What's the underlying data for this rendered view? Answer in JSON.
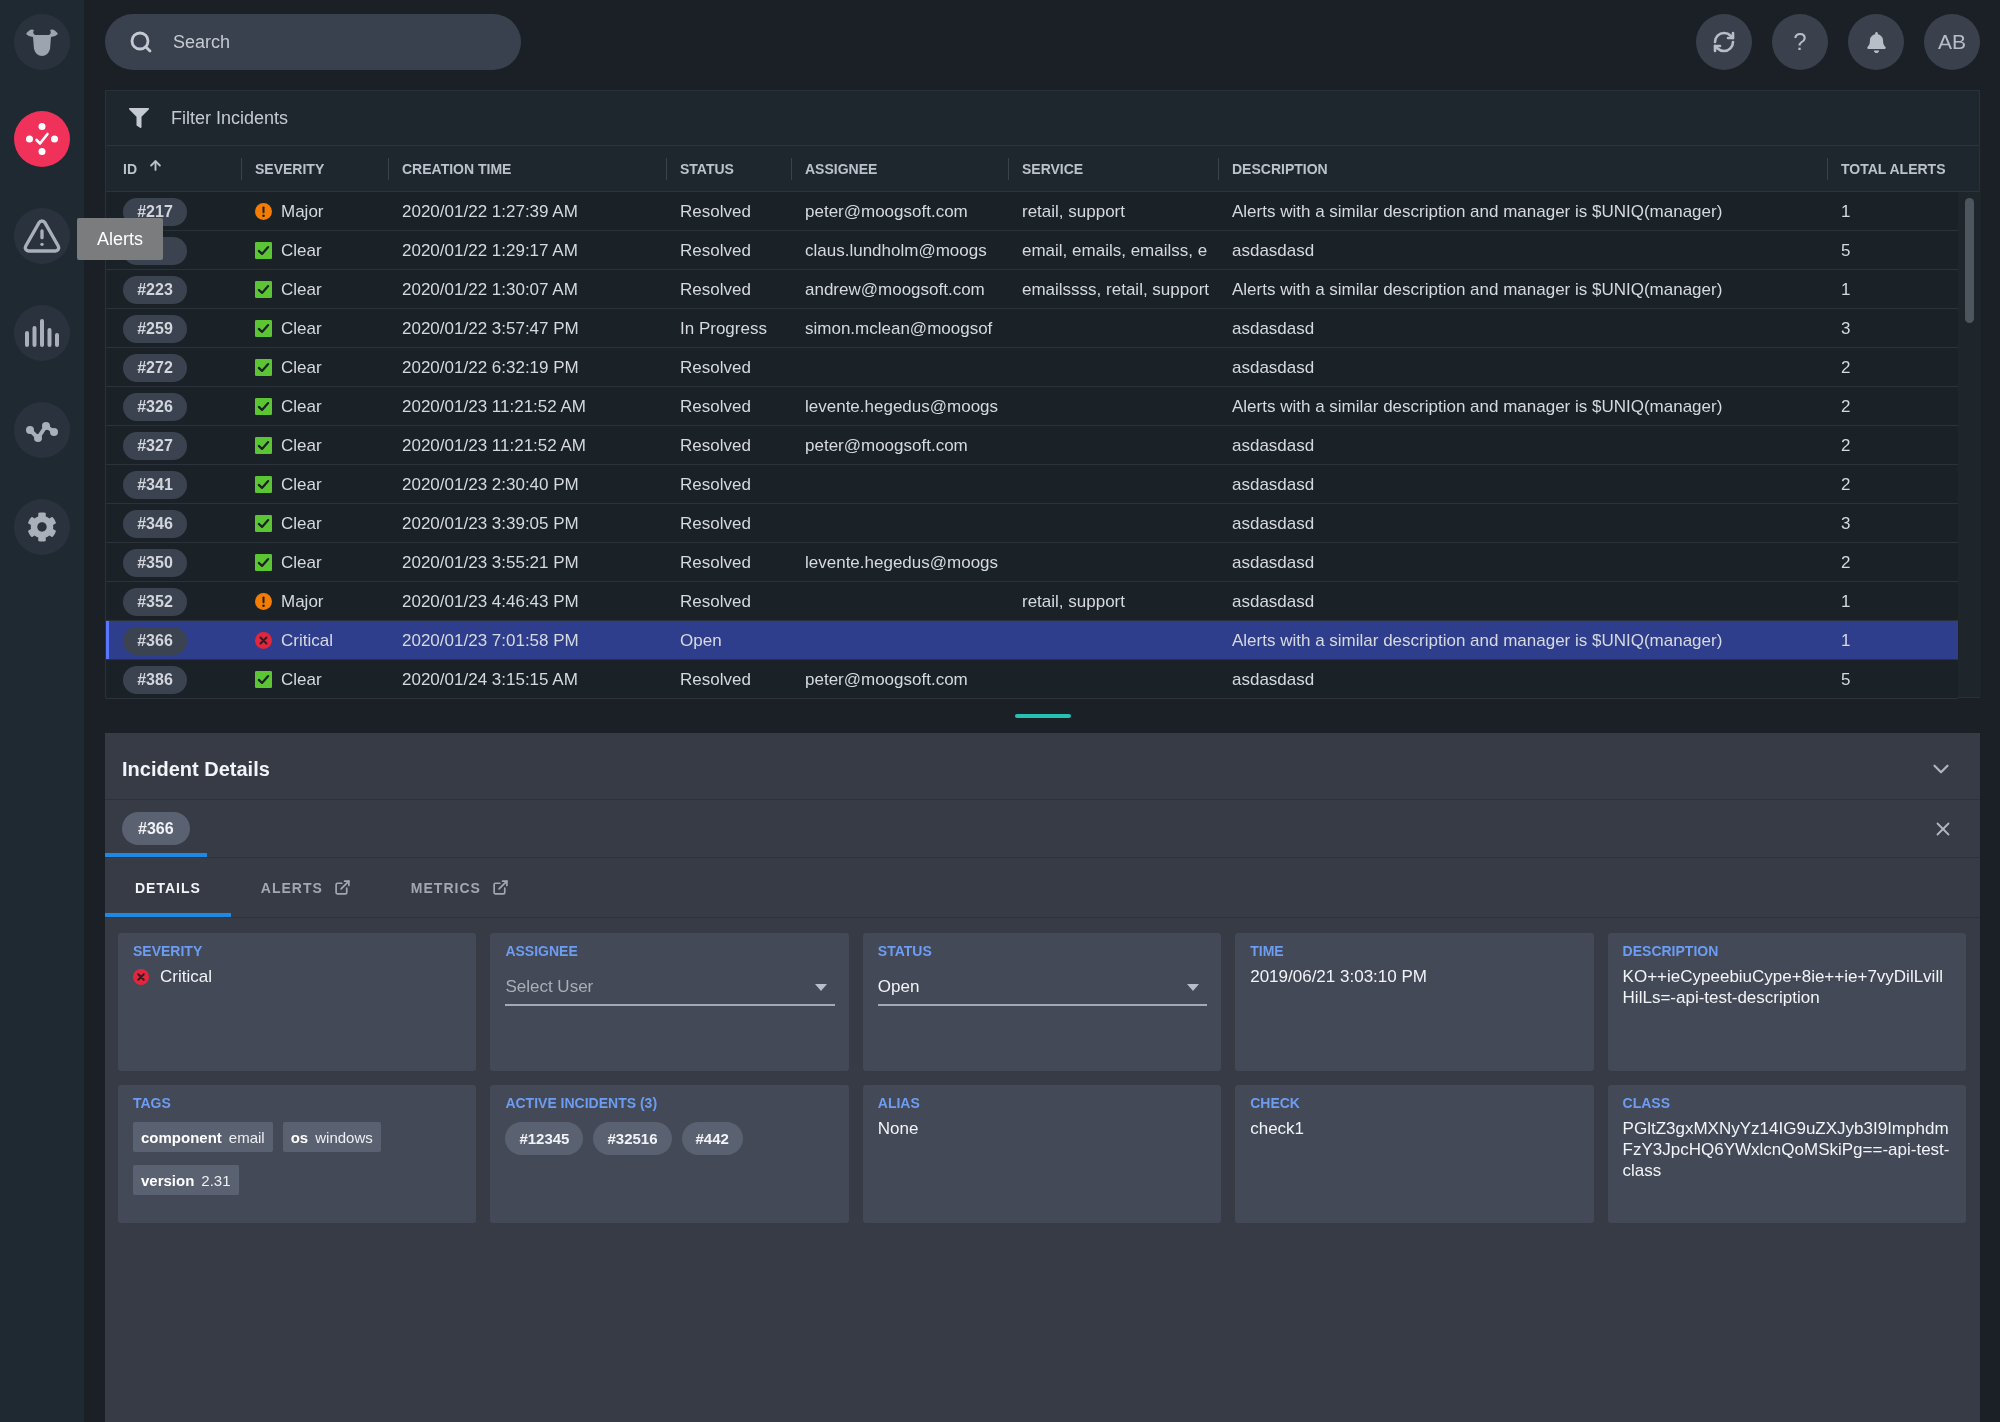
{
  "sidebar": {
    "items": [
      {
        "kind": "incidents",
        "selected": true
      },
      {
        "kind": "alerts",
        "selected": false,
        "tooltip": "Alerts"
      },
      {
        "kind": "analytics",
        "selected": false
      },
      {
        "kind": "topology",
        "selected": false
      },
      {
        "kind": "settings",
        "selected": false
      }
    ]
  },
  "top_bar": {
    "search": {
      "placeholder": "Search"
    },
    "actions": [
      {
        "kind": "refresh"
      },
      {
        "kind": "help",
        "label": "?"
      },
      {
        "kind": "notifications"
      }
    ],
    "avatar": "AB"
  },
  "incidents_table": {
    "filter": {
      "placeholder": "Filter Incidents"
    },
    "columns": [
      {
        "label": "ID",
        "sorted": true
      },
      {
        "label": "SEVERITY",
        "sorted": false
      },
      {
        "label": "CREATION TIME",
        "sorted": false
      },
      {
        "label": "STATUS",
        "sorted": false
      },
      {
        "label": "ASSIGNEE",
        "sorted": false
      },
      {
        "label": "SERVICE",
        "sorted": false
      },
      {
        "label": "DESCRIPTION",
        "sorted": false
      },
      {
        "label": "TOTAL ALERTS",
        "sorted": false
      }
    ],
    "rows": [
      {
        "id": "#217",
        "severity": {
          "label": "Major",
          "kind": "major"
        },
        "creation_time": "2020/01/22 1:27:39 AM",
        "status": "Resolved",
        "assignee": "peter@moogsoft.com",
        "service": "retail, support",
        "description": "Alerts with a similar description and manager is $UNIQ(manager)",
        "total_alerts": "1",
        "selected": false
      },
      {
        "severity": {
          "label": "Clear",
          "kind": "clear"
        },
        "creation_time": "2020/01/22 1:29:17 AM",
        "status": "Resolved",
        "assignee": "claus.lundholm@moogs",
        "service": "email, emails, emailss, e",
        "description": "asdasdasd",
        "total_alerts": "5",
        "selected": false
      },
      {
        "id": "#223",
        "severity": {
          "label": "Clear",
          "kind": "clear"
        },
        "creation_time": "2020/01/22 1:30:07 AM",
        "status": "Resolved",
        "assignee": "andrew@moogsoft.com",
        "service": "emailssss, retail, support",
        "description": "Alerts with a similar description and manager is $UNIQ(manager)",
        "total_alerts": "1",
        "selected": false
      },
      {
        "id": "#259",
        "severity": {
          "label": "Clear",
          "kind": "clear"
        },
        "creation_time": "2020/01/22 3:57:47 PM",
        "status": "In Progress",
        "assignee": "simon.mclean@moogsof",
        "description": "asdasdasd",
        "total_alerts": "3",
        "selected": false
      },
      {
        "id": "#272",
        "severity": {
          "label": "Clear",
          "kind": "clear"
        },
        "creation_time": "2020/01/22 6:32:19 PM",
        "status": "Resolved",
        "description": "asdasdasd",
        "total_alerts": "2",
        "selected": false
      },
      {
        "id": "#326",
        "severity": {
          "label": "Clear",
          "kind": "clear"
        },
        "creation_time": "2020/01/23 11:21:52 AM",
        "status": "Resolved",
        "assignee": "levente.hegedus@moogs",
        "description": "Alerts with a similar description and manager is $UNIQ(manager)",
        "total_alerts": "2",
        "selected": false
      },
      {
        "id": "#327",
        "severity": {
          "label": "Clear",
          "kind": "clear"
        },
        "creation_time": "2020/01/23 11:21:52 AM",
        "status": "Resolved",
        "assignee": "peter@moogsoft.com",
        "description": "asdasdasd",
        "total_alerts": "2",
        "selected": false
      },
      {
        "id": "#341",
        "severity": {
          "label": "Clear",
          "kind": "clear"
        },
        "creation_time": "2020/01/23 2:30:40 PM",
        "status": "Resolved",
        "description": "asdasdasd",
        "total_alerts": "2",
        "selected": false
      },
      {
        "id": "#346",
        "severity": {
          "label": "Clear",
          "kind": "clear"
        },
        "creation_time": "2020/01/23 3:39:05 PM",
        "status": "Resolved",
        "description": "asdasdasd",
        "total_alerts": "3",
        "selected": false
      },
      {
        "id": "#350",
        "severity": {
          "label": "Clear",
          "kind": "clear"
        },
        "creation_time": "2020/01/23 3:55:21 PM",
        "status": "Resolved",
        "assignee": "levente.hegedus@moogs",
        "description": "asdasdasd",
        "total_alerts": "2",
        "selected": false
      },
      {
        "id": "#352",
        "severity": {
          "label": "Major",
          "kind": "major"
        },
        "creation_time": "2020/01/23 4:46:43 PM",
        "status": "Resolved",
        "service": "retail, support",
        "description": "asdasdasd",
        "total_alerts": "1",
        "selected": false
      },
      {
        "id": "#366",
        "severity": {
          "label": "Critical",
          "kind": "critical"
        },
        "creation_time": "2020/01/23 7:01:58 PM",
        "status": "Open",
        "description": "Alerts with a similar description and manager is $UNIQ(manager)",
        "total_alerts": "1",
        "selected": true
      },
      {
        "id": "#386",
        "severity": {
          "label": "Clear",
          "kind": "clear"
        },
        "creation_time": "2020/01/24 3:15:15 AM",
        "status": "Resolved",
        "assignee": "peter@moogsoft.com",
        "description": "asdasdasd",
        "total_alerts": "5",
        "selected": false
      }
    ]
  },
  "incident_details": {
    "title": "Incident Details",
    "open_incidents": [
      {
        "label": "#366",
        "selected": true
      }
    ],
    "tabs": [
      {
        "label": "DETAILS",
        "selected": true,
        "external": false
      },
      {
        "label": "ALERTS",
        "selected": false,
        "external": true
      },
      {
        "label": "METRICS",
        "selected": false,
        "external": true
      }
    ],
    "cards": [
      {
        "kind": "severity",
        "label": "SEVERITY",
        "severity": {
          "label": "Critical",
          "kind": "critical"
        }
      },
      {
        "kind": "select",
        "label": "ASSIGNEE",
        "placeholder": "Select User"
      },
      {
        "kind": "select",
        "label": "STATUS",
        "value": "Open"
      },
      {
        "kind": "text",
        "label": "TIME",
        "value": "2019/06/21 3:03:10 PM"
      },
      {
        "kind": "text",
        "label": "DESCRIPTION",
        "value": "KO++ieCypeebiuCype+8ie++ie+7vyDilLvillHilLs=-api-test-description"
      },
      {
        "kind": "tags",
        "label": "TAGS",
        "tags": [
          {
            "key": "component",
            "value": "email"
          },
          {
            "key": "os",
            "value": "windows"
          },
          {
            "key": "version",
            "value": "2.31"
          }
        ]
      },
      {
        "kind": "pills",
        "label": "ACTIVE INCIDENTS (3)",
        "pills": [
          "#12345",
          "#32516",
          "#442"
        ]
      },
      {
        "kind": "text",
        "label": "ALIAS",
        "value": "None"
      },
      {
        "kind": "text",
        "label": "CHECK",
        "value": "check1"
      },
      {
        "kind": "text",
        "label": "CLASS",
        "value": "PGltZ3gxMXNyYz14IG9uZXJyb3I9ImphdmFzY3JpcHQ6YWxlcnQoMSkiPg==-api-test-class"
      }
    ]
  }
}
